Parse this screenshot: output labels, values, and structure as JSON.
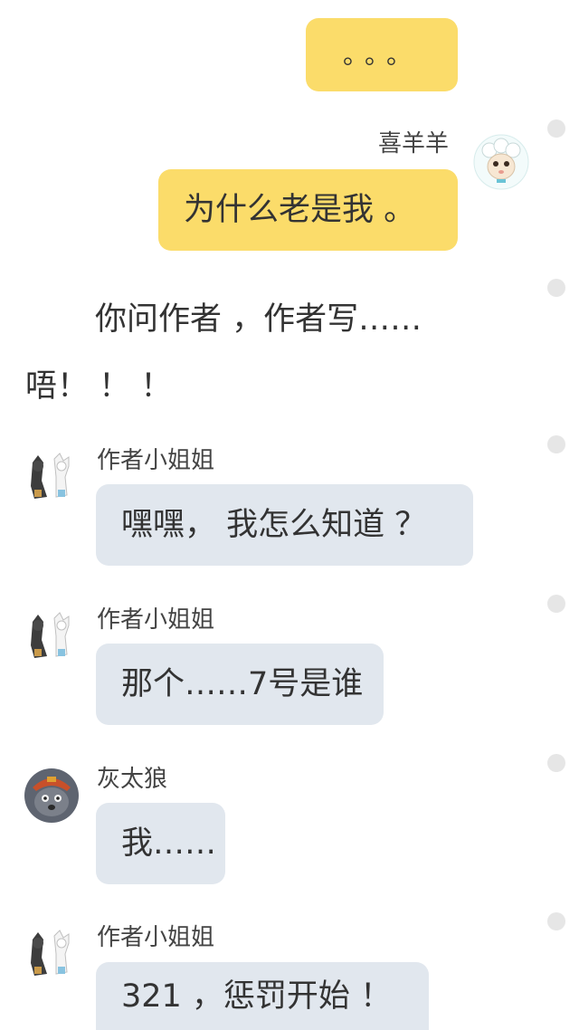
{
  "messages": [
    {
      "side": "right",
      "text": "。。。",
      "sender": ""
    },
    {
      "side": "right",
      "sender": "喜羊羊",
      "text": "为什么老是我 。"
    },
    {
      "side": "left",
      "sender": "作者小姐姐",
      "text": "嘿嘿， 我怎么知道 ？"
    },
    {
      "side": "left",
      "sender": "作者小姐姐",
      "text": "那个……7号是谁"
    },
    {
      "side": "left",
      "sender": "灰太狼",
      "text": "我……"
    },
    {
      "side": "left",
      "sender": "作者小姐姐",
      "text": "321 ，惩罚开始 ！"
    }
  ],
  "narration": [
    "你问作者 ，作者写……",
    "唔！ ！ ！"
  ],
  "colors": {
    "self_bubble": "#fbdc6a",
    "other_bubble": "#e1e7ee",
    "background": "#ffffff",
    "side_dot": "#e6e6e6"
  },
  "icons": {
    "xiyangyang": "sheep-avatar-icon",
    "author": "wolf-and-sheep-author-avatar-icon",
    "huitailang": "grey-wolf-avatar-icon"
  }
}
